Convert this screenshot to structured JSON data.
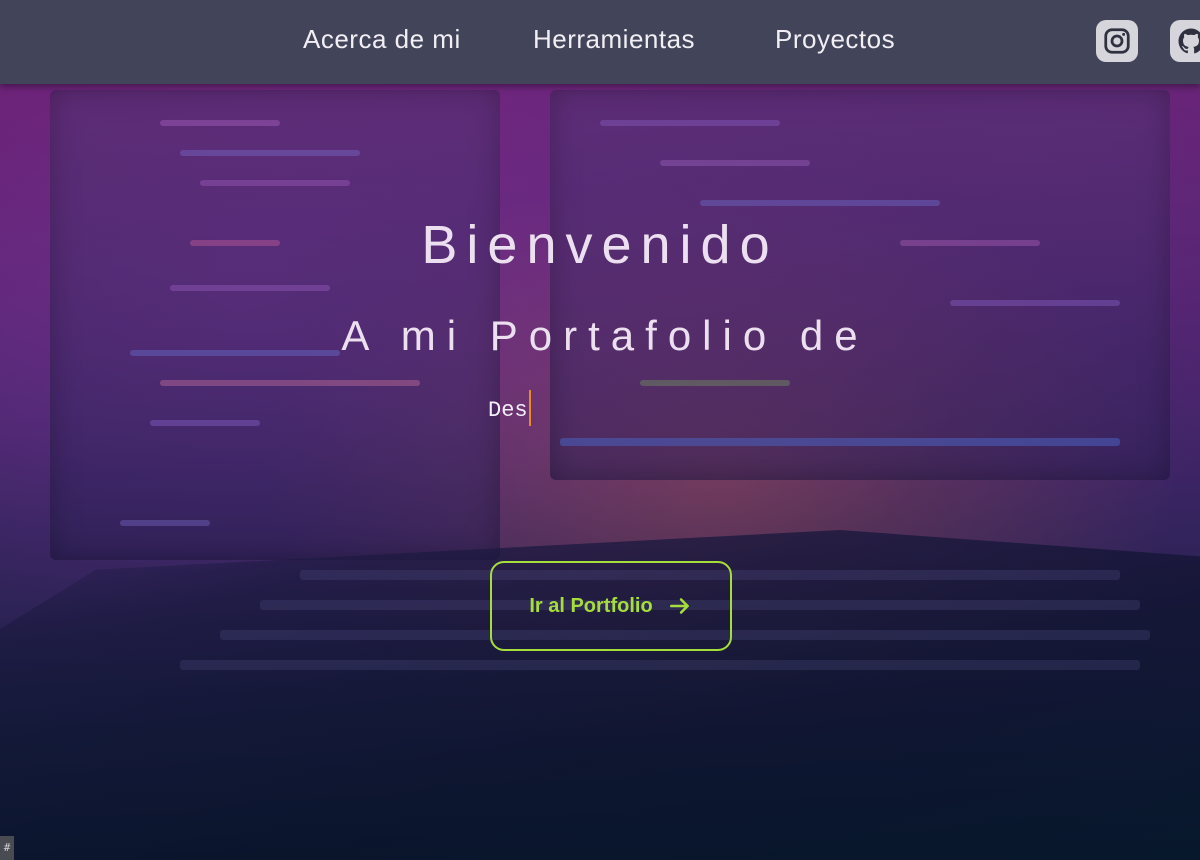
{
  "nav": {
    "links": [
      {
        "label": "Acerca de mi"
      },
      {
        "label": "Herramientas"
      },
      {
        "label": "Proyectos"
      }
    ],
    "social": [
      {
        "name": "instagram-icon"
      },
      {
        "name": "github-icon"
      }
    ]
  },
  "hero": {
    "title": "Bienvenido",
    "subtitle": "A mi Portafolio de",
    "typed_text": "Des"
  },
  "cta": {
    "label": "Ir al Portfolio",
    "icon": "arrow-right-icon"
  },
  "corner_badge": "#",
  "colors": {
    "navbar": "#424559",
    "accent": "#a5dd3a",
    "caret": "#e68a2e",
    "hero_text": "#ecdff0"
  }
}
